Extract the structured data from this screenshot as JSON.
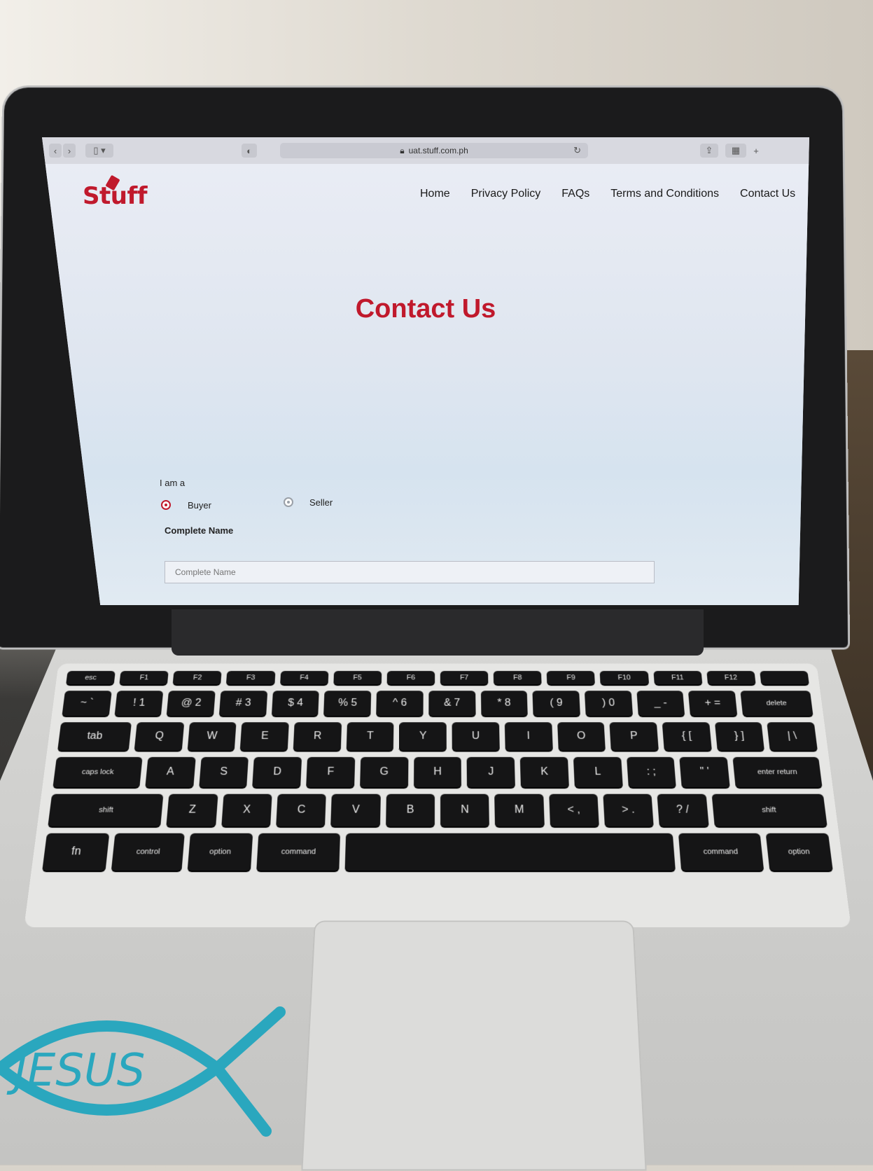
{
  "browser": {
    "url": "uat.stuff.com.ph"
  },
  "site": {
    "logo_text": "Stuff",
    "nav": [
      "Home",
      "Privacy Policy",
      "FAQs",
      "Terms and Conditions",
      "Contact Us"
    ],
    "brand_color": "#c0192c"
  },
  "hero": {
    "title": "Contact Us"
  },
  "form": {
    "role_label": "I am a",
    "options": [
      {
        "label": "Buyer",
        "selected": true
      },
      {
        "label": "Seller",
        "selected": false
      }
    ],
    "name_label": "Complete Name",
    "name_placeholder": "Complete Name"
  },
  "keyboard": {
    "row_fn": [
      "esc",
      "F1",
      "F2",
      "F3",
      "F4",
      "F5",
      "F6",
      "F7",
      "F8",
      "F9",
      "F10",
      "F11",
      "F12",
      ""
    ],
    "row_num": [
      "~ `",
      "! 1",
      "@ 2",
      "# 3",
      "$ 4",
      "% 5",
      "^ 6",
      "& 7",
      "* 8",
      "( 9",
      ") 0",
      "_ -",
      "+ =",
      "delete"
    ],
    "row_q": [
      "tab",
      "Q",
      "W",
      "E",
      "R",
      "T",
      "Y",
      "U",
      "I",
      "O",
      "P",
      "{ [",
      "} ]",
      "| \\"
    ],
    "row_a": [
      "caps lock",
      "A",
      "S",
      "D",
      "F",
      "G",
      "H",
      "J",
      "K",
      "L",
      ": ;",
      "\" '",
      "enter return"
    ],
    "row_z": [
      "shift",
      "Z",
      "X",
      "C",
      "V",
      "B",
      "N",
      "M",
      "< ,",
      "> .",
      "? /",
      "shift"
    ],
    "row_bottom": [
      "fn",
      "control",
      "option",
      "command",
      "",
      "command",
      "option"
    ]
  },
  "sticker_text": "JESUS"
}
